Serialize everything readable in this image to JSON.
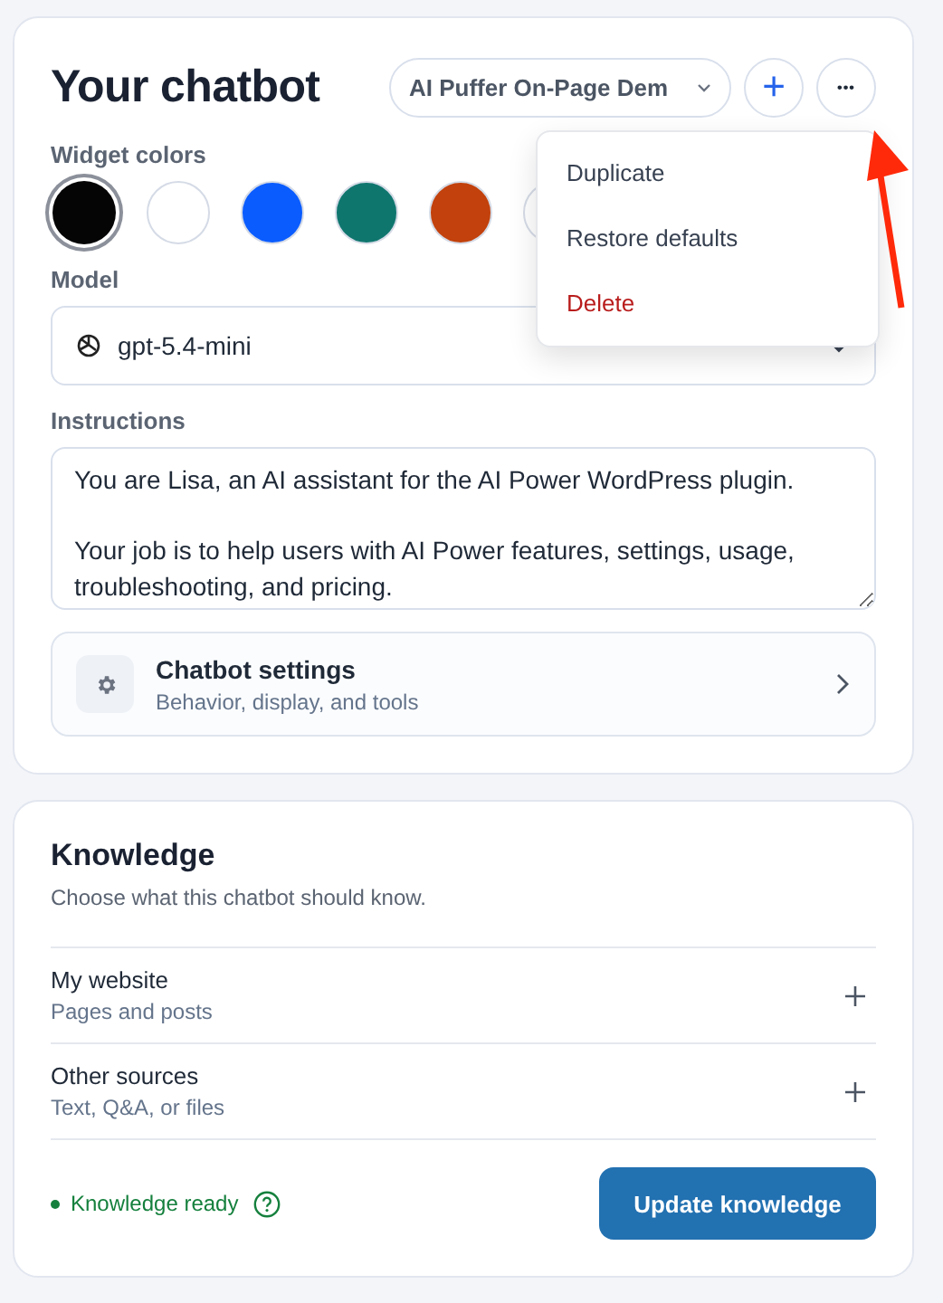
{
  "chatbot": {
    "title": "Your chatbot",
    "bot_select": {
      "value": "AI Puffer On-Page Dem"
    },
    "add_button": "+",
    "more_button": "•••",
    "menu": [
      {
        "label": "Duplicate",
        "kind": "normal"
      },
      {
        "label": "Restore defaults",
        "kind": "normal"
      },
      {
        "label": "Delete",
        "kind": "danger"
      }
    ],
    "colors_label": "Widget colors",
    "colors": [
      {
        "color": "#050505",
        "selected": true
      },
      {
        "color": "#ffffff",
        "selected": false
      },
      {
        "color": "#0a5cff",
        "selected": false
      },
      {
        "color": "#0f766e",
        "selected": false
      },
      {
        "color": "#c2410c",
        "selected": false
      },
      {
        "color": "#ffffff",
        "selected": false
      }
    ],
    "model_label": "Model",
    "model": "gpt-5.4-mini",
    "instructions_label": "Instructions",
    "instructions": "You are Lisa, an AI assistant for the AI Power WordPress plugin.\n\nYour job is to help users with AI Power features, settings, usage, troubleshooting, and pricing.",
    "settings": {
      "title": "Chatbot settings",
      "subtitle": "Behavior, display, and tools"
    }
  },
  "knowledge": {
    "title": "Knowledge",
    "subtitle": "Choose what this chatbot should know.",
    "sources": [
      {
        "title": "My website",
        "subtitle": "Pages and posts"
      },
      {
        "title": "Other sources",
        "subtitle": "Text, Q&A, or files"
      }
    ],
    "status": "Knowledge ready",
    "ready": true,
    "button": "Update knowledge"
  }
}
